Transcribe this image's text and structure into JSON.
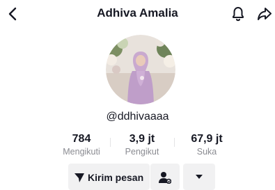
{
  "header": {
    "title": "Adhiva Amalia",
    "back_icon": "chevron-left-icon",
    "bell_icon": "bell-icon",
    "share_icon": "share-icon"
  },
  "profile": {
    "username": "@ddhivaaaa"
  },
  "stats": [
    {
      "value": "784",
      "label": "Mengikuti"
    },
    {
      "value": "3,9 jt",
      "label": "Pengikut"
    },
    {
      "value": "67,9 jt",
      "label": "Suka"
    }
  ],
  "actions": {
    "message_label": "Kirim pesan",
    "message_icon": "send-icon",
    "friend_icon": "add-friend-icon",
    "more_icon": "caret-down-icon"
  },
  "colors": {
    "text": "#161823",
    "muted": "#8a8b91",
    "button_bg": "#f1f1f2"
  }
}
